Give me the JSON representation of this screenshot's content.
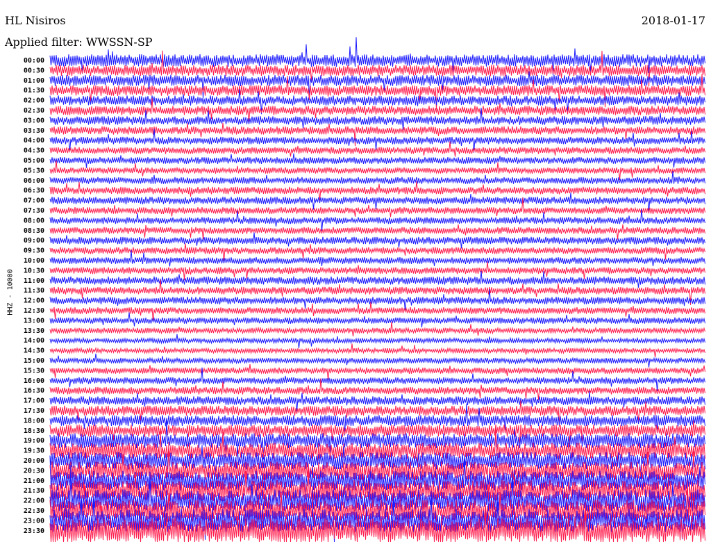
{
  "header": {
    "station": "HL Nisiros",
    "date": "2018-01-17",
    "filter_label": "Applied filter:",
    "filter_value": "WWSSN-SP"
  },
  "chart_data": {
    "type": "line",
    "title": "HL Nisiros",
    "ylabel": "HHZ - 10000",
    "rows": [
      "00:00",
      "00:30",
      "01:00",
      "01:30",
      "02:00",
      "02:30",
      "03:00",
      "03:30",
      "04:00",
      "04:30",
      "05:00",
      "05:30",
      "06:00",
      "06:30",
      "07:00",
      "07:30",
      "08:00",
      "08:30",
      "09:00",
      "09:30",
      "10:00",
      "10:30",
      "11:00",
      "11:30",
      "12:00",
      "12:30",
      "13:00",
      "13:30",
      "14:00",
      "14:30",
      "15:00",
      "15:30",
      "16:00",
      "16:30",
      "17:00",
      "17:30",
      "18:00",
      "18:30",
      "19:00",
      "19:30",
      "20:00",
      "20:30",
      "21:00",
      "21:30",
      "22:00",
      "22:30",
      "23:00",
      "23:30"
    ],
    "trace_colors": [
      "#1a1aff",
      "#ff1a4b"
    ],
    "trace_order": "alternating, starting with blue at 00:00",
    "relative_noise_amplitude": [
      1.0,
      0.9,
      0.9,
      0.85,
      0.8,
      0.75,
      0.7,
      0.65,
      0.6,
      0.55,
      0.55,
      0.5,
      0.55,
      0.6,
      0.6,
      0.55,
      0.55,
      0.55,
      0.6,
      0.55,
      0.55,
      0.55,
      0.65,
      0.6,
      0.6,
      0.55,
      0.5,
      0.45,
      0.4,
      0.4,
      0.45,
      0.5,
      0.55,
      0.6,
      0.7,
      0.8,
      0.9,
      1.0,
      1.2,
      1.3,
      1.4,
      1.5,
      1.6,
      1.7,
      1.8,
      1.8,
      1.9,
      2.0
    ]
  }
}
